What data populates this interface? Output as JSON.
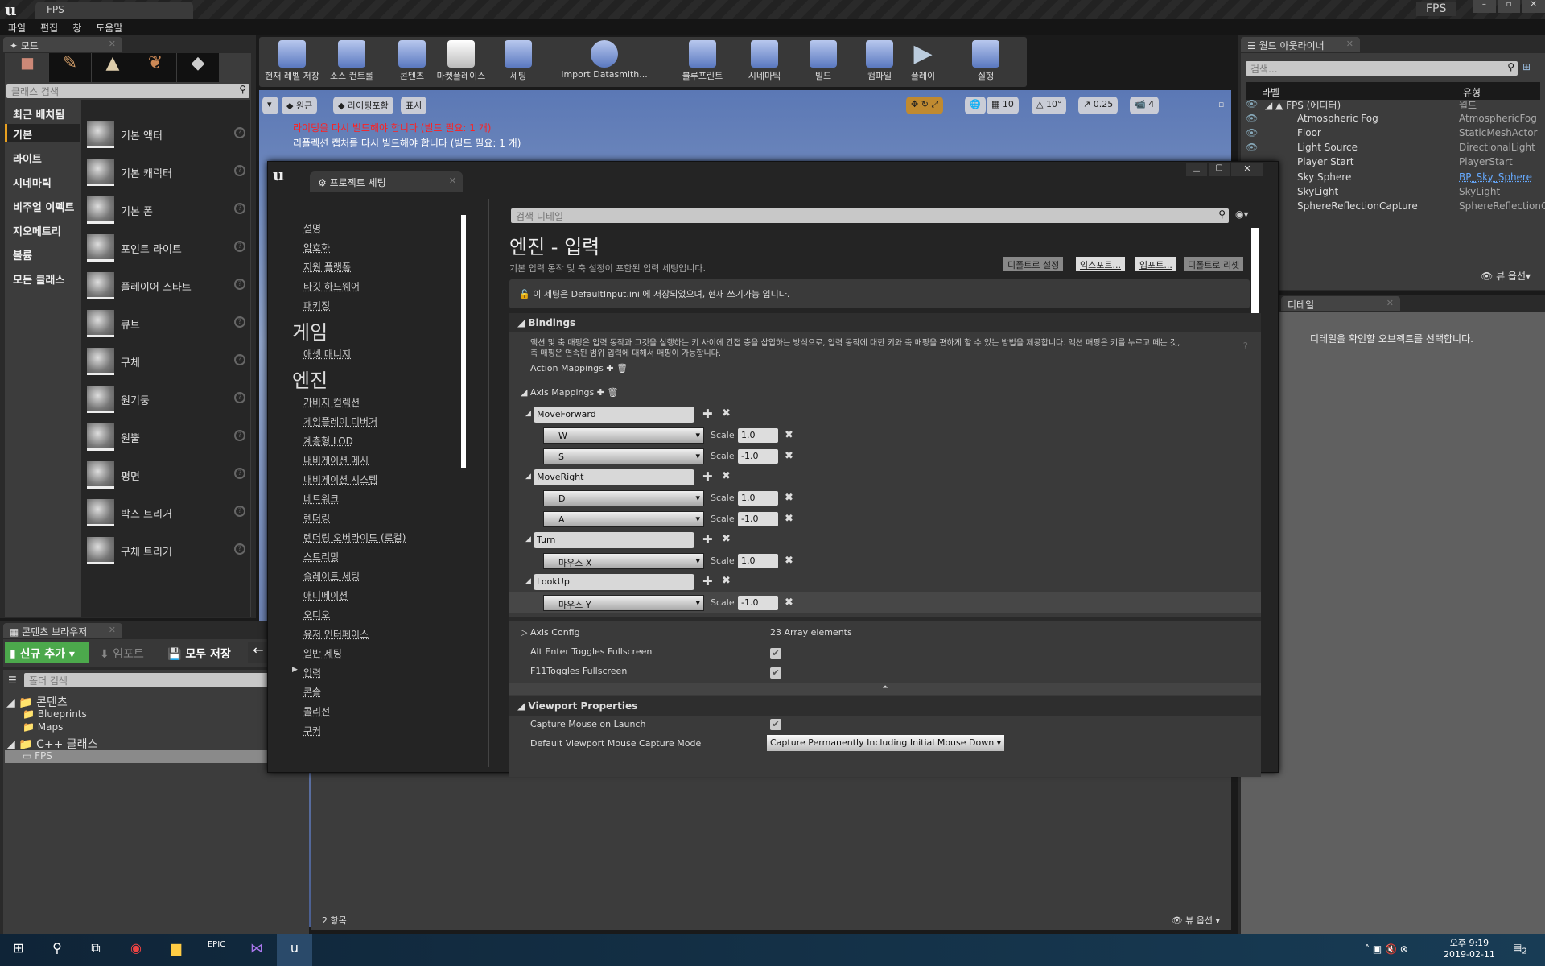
{
  "window": {
    "title": "FPS",
    "app_badge": "FPS"
  },
  "menu": [
    "파일",
    "편집",
    "창",
    "도움말"
  ],
  "modes": {
    "tab": "모드",
    "search_placeholder": "클래스 검색",
    "categories": [
      "최근 배치됨",
      "기본",
      "라이트",
      "시네마틱",
      "비주얼 이펙트",
      "지오메트리",
      "볼륨",
      "모든 클래스"
    ],
    "selected_category": "기본",
    "items": [
      "기본 액터",
      "기본 캐릭터",
      "기본 폰",
      "포인트 라이트",
      "플레이어 스타트",
      "큐브",
      "구체",
      "원기둥",
      "원뿔",
      "평면",
      "박스 트리거",
      "구체 트리거"
    ]
  },
  "toolbar": [
    "현재 레벨 저장",
    "소스 컨트롤",
    "콘텐츠",
    "마켓플레이스",
    "세팅",
    "Import Datasmith...",
    "블루프린트",
    "시네마틱",
    "빌드",
    "컴파일",
    "플레이",
    "실행"
  ],
  "viewport": {
    "buttons": [
      "원근",
      "라이팅포함",
      "표시"
    ],
    "snap": {
      "grid": "10",
      "rotation": "10°",
      "scale": "0.25",
      "camera_speed": "4"
    },
    "warning_red": "라이팅을 다시 빌드해야 합니다 (빌드 필요: 1 개)",
    "warning_white": "리플렉션 캡처를 다시 빌드해야 합니다 (빌드 필요: 1 개)",
    "warning_red_color": "#ff2020"
  },
  "outliner": {
    "tab": "월드 아웃라이너",
    "search_placeholder": "검색...",
    "col_label": "라벨",
    "col_type": "유형",
    "rows": [
      {
        "name": "FPS (에디터)",
        "type": "월드"
      },
      {
        "name": "Atmospheric Fog",
        "type": "AtmosphericFog"
      },
      {
        "name": "Floor",
        "type": "StaticMeshActor"
      },
      {
        "name": "Light Source",
        "type": "DirectionalLight"
      },
      {
        "name": "Player Start",
        "type": "PlayerStart"
      },
      {
        "name": "Sky Sphere",
        "type": "BP_Sky_Sphere"
      },
      {
        "name": "SkyLight",
        "type": "SkyLight"
      },
      {
        "name": "SphereReflectionCapture",
        "type": "SphereReflectionC"
      }
    ],
    "view_options": "뷰 옵션"
  },
  "details": {
    "tab": "디테일",
    "empty": "디테일을 확인할 오브젝트를 선택합니다."
  },
  "content_browser": {
    "tab": "콘텐츠 브라우저",
    "add_new": "신규 추가",
    "import": "임포트",
    "save_all": "모두 저장",
    "folder_search": "폴더 검색",
    "tree": [
      "콘텐츠",
      "Blueprints",
      "Maps",
      "C++ 클래스",
      "FPS"
    ],
    "item_count": "2 항목",
    "view_options": "뷰 옵션"
  },
  "settings": {
    "tab": "프로젝트 세팅",
    "nav": {
      "top_items": [
        "설명",
        "암호화",
        "지원 플랫폼",
        "타깃 하드웨어",
        "패키징"
      ],
      "game_header": "게임",
      "game_items": [
        "애셋 매니저"
      ],
      "engine_header": "엔진",
      "engine_items": [
        "가비지 컬렉션",
        "게임플레이 디버거",
        "계층형 LOD",
        "내비게이션 메시",
        "내비게이션 시스템",
        "네트워크",
        "렌더링",
        "렌더링 오버라이드 (로컬)",
        "스트리밍",
        "슬레이트 세팅",
        "애니메이션",
        "오디오",
        "유저 인터페이스",
        "일반 세팅",
        "입력",
        "콘솔",
        "콜리전",
        "쿠커"
      ],
      "selected": "입력"
    },
    "search_placeholder": "검색 디테일",
    "title": "엔진 - 입력",
    "description": "기본 입력 동작 및 축 설정이 포함된 입력 세팅입니다.",
    "buttons": [
      "디폴트로 설정",
      "익스포트...",
      "임포트...",
      "디폴트로 리셋"
    ],
    "info": "이 세팅은 DefaultInput.ini 에 저장되었으며, 현재 쓰기가능 입니다.",
    "bindings": {
      "header": "Bindings",
      "help1": "액션 및 축 매핑은 입력 동작과 그것을 실행하는 키 사이에 간접 층을 삽입하는 방식으로, 입력 동작에 대한 키와 축 매핑을 편하게 할 수 있는 방법을 제공합니다. 액션 매핑은 키를 누르고 떼는 것,",
      "help2": "축 매핑은 연속된 범위 입력에 대해서 매핑이 가능합니다.",
      "action_mappings": "Action Mappings",
      "axis_mappings": "Axis Mappings",
      "scale_label": "Scale",
      "axes": [
        {
          "name": "MoveForward",
          "keys": [
            {
              "key": "W",
              "scale": "1.0"
            },
            {
              "key": "S",
              "scale": "-1.0"
            }
          ]
        },
        {
          "name": "MoveRight",
          "keys": [
            {
              "key": "D",
              "scale": "1.0"
            },
            {
              "key": "A",
              "scale": "-1.0"
            }
          ]
        },
        {
          "name": "Turn",
          "keys": [
            {
              "key": "마우스 X",
              "scale": "1.0"
            }
          ]
        },
        {
          "name": "LookUp",
          "keys": [
            {
              "key": "마우스 Y",
              "scale": "-1.0"
            }
          ]
        }
      ],
      "axis_config": "Axis Config",
      "axis_config_value": "23 Array elements",
      "alt_enter": "Alt Enter Toggles Fullscreen",
      "f11": "F11Toggles Fullscreen"
    },
    "viewport_props": {
      "header": "Viewport Properties",
      "capture_mouse": "Capture Mouse on Launch",
      "capture_mode_label": "Default Viewport Mouse Capture Mode",
      "capture_mode_value": "Capture Permanently Including Initial Mouse Down"
    }
  },
  "taskbar": {
    "time": "오후 9:19",
    "date": "2019-02-11",
    "notifications": "2"
  }
}
